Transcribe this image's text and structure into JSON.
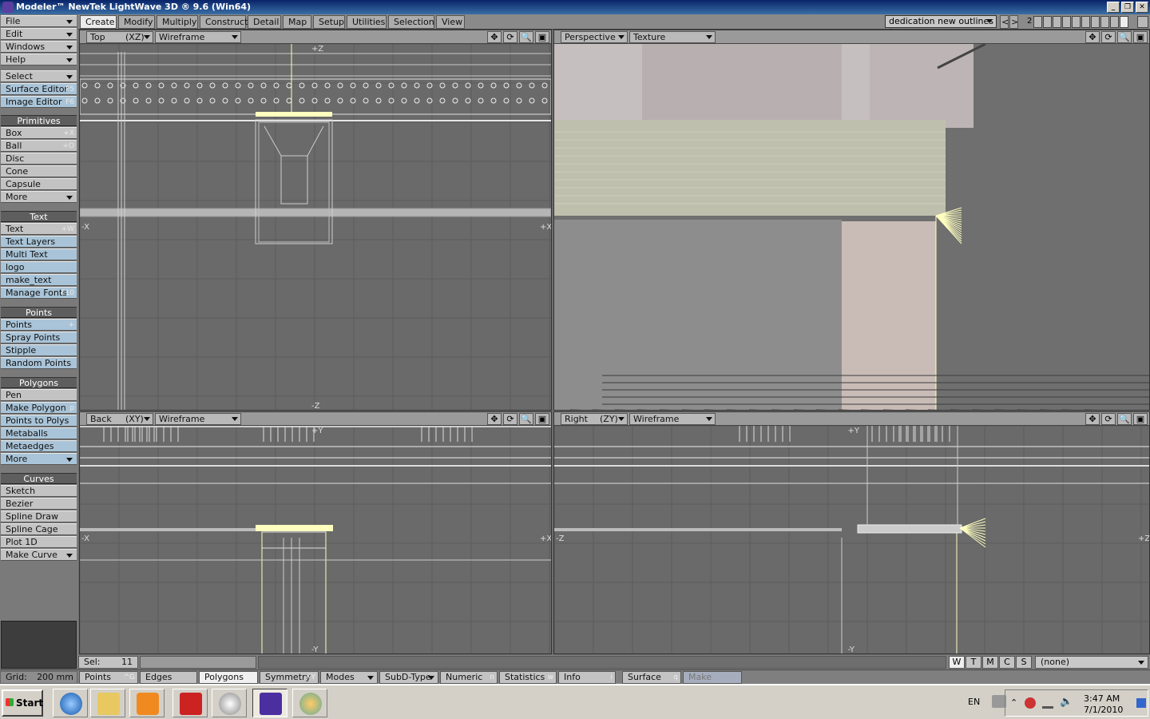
{
  "window": {
    "title": "Modeler™ NewTek LightWave 3D ® 9.6  (Win64)",
    "controls": [
      "_",
      "❐",
      "✕"
    ]
  },
  "sidebar": {
    "menus": [
      {
        "label": "File"
      },
      {
        "label": "Edit"
      },
      {
        "label": "Windows"
      },
      {
        "label": "Help"
      }
    ],
    "select": {
      "label": "Select"
    },
    "editors": [
      {
        "label": "Surface Editor",
        "key": "F5"
      },
      {
        "label": "Image Editor",
        "key": "F6"
      }
    ],
    "groups": [
      {
        "title": "Primitives",
        "items": [
          {
            "label": "Box",
            "key": "+X"
          },
          {
            "label": "Ball",
            "key": "+O"
          },
          {
            "label": "Disc",
            "key": ""
          },
          {
            "label": "Cone",
            "key": ""
          },
          {
            "label": "Capsule",
            "key": ""
          },
          {
            "label": "More",
            "key": "",
            "dd": true
          }
        ]
      },
      {
        "title": "Text",
        "items": [
          {
            "label": "Text",
            "key": "+W"
          },
          {
            "label": "Text Layers",
            "key": ""
          },
          {
            "label": "Multi Text",
            "key": ""
          },
          {
            "label": "logo",
            "key": ""
          },
          {
            "label": "make_text",
            "key": ""
          },
          {
            "label": "Manage Fonts",
            "key": "F10"
          }
        ]
      },
      {
        "title": "Points",
        "items": [
          {
            "label": "Points",
            "key": "+"
          },
          {
            "label": "Spray Points",
            "key": ""
          },
          {
            "label": "Stipple",
            "key": ""
          },
          {
            "label": "Random Points",
            "key": ""
          }
        ]
      },
      {
        "title": "Polygons",
        "items": [
          {
            "label": "Pen",
            "key": ""
          },
          {
            "label": "Make Polygon",
            "key": "p"
          },
          {
            "label": "Points to Polys",
            "key": ""
          },
          {
            "label": "Metaballs",
            "key": ""
          },
          {
            "label": "Metaedges",
            "key": ""
          },
          {
            "label": "More",
            "key": "",
            "dd": true
          }
        ]
      },
      {
        "title": "Curves",
        "items": [
          {
            "label": "Sketch",
            "key": ""
          },
          {
            "label": "Bezier",
            "key": ""
          },
          {
            "label": "Spline Draw",
            "key": ""
          },
          {
            "label": "Spline Cage",
            "key": ""
          },
          {
            "label": "Plot 1D",
            "key": ""
          },
          {
            "label": "Make Curve",
            "key": "",
            "dd": true
          }
        ]
      }
    ]
  },
  "tabs": [
    {
      "label": "Create",
      "active": true
    },
    {
      "label": "Modify"
    },
    {
      "label": "Multiply"
    },
    {
      "label": "Construct"
    },
    {
      "label": "Detail"
    },
    {
      "label": "Map"
    },
    {
      "label": "Setup"
    },
    {
      "label": "Utilities"
    },
    {
      "label": "Selection"
    },
    {
      "label": "View"
    }
  ],
  "scene_selector": {
    "value": "dedication new outlines *",
    "layer_nav": [
      "<",
      ">"
    ],
    "layer_number": "2"
  },
  "viewports": [
    {
      "view": "Top",
      "axis": "(XZ)",
      "mode": "Wireframe",
      "labels": {
        "top": "+Z",
        "bottom": "-Z",
        "left": "-X",
        "right": "+X"
      }
    },
    {
      "view": "Perspective",
      "axis": "",
      "mode": "Texture",
      "labels": {}
    },
    {
      "view": "Back",
      "axis": "(XY)",
      "mode": "Wireframe",
      "labels": {
        "top": "+Y",
        "bottom": "-Y",
        "left": "-X",
        "right": "+X"
      }
    },
    {
      "view": "Right",
      "axis": "(ZY)",
      "mode": "Wireframe",
      "labels": {
        "top": "+Y",
        "bottom": "-Y",
        "left": "-Z",
        "right": "+Z"
      }
    }
  ],
  "viewport_icons": [
    "✥",
    "⟳",
    "🔍",
    "▣"
  ],
  "status": {
    "sel_label": "Sel:",
    "sel_count": "11",
    "wtmcs": [
      "W",
      "T",
      "M",
      "C",
      "S"
    ],
    "surface_value": "(none)"
  },
  "bottom": {
    "grid_label": "Grid:",
    "grid_value": "200 mm",
    "buttons": [
      {
        "label": "Points",
        "key": "^G"
      },
      {
        "label": "Edges",
        "key": ""
      },
      {
        "label": "Polygons",
        "key": "^H"
      },
      {
        "label": "Symmetry",
        "key": "+Y"
      },
      {
        "label": "Modes",
        "key": "",
        "dd": true
      },
      {
        "label": "SubD-Type",
        "key": "",
        "dd": true
      },
      {
        "label": "Numeric",
        "key": "n"
      },
      {
        "label": "Statistics",
        "key": "w"
      },
      {
        "label": "Info",
        "key": "i"
      },
      {
        "label": "Surface",
        "key": "q"
      },
      {
        "label": "Make",
        "key": ""
      }
    ]
  },
  "taskbar": {
    "start": "Start",
    "language": "EN",
    "time": "3:47 AM",
    "date": "7/1/2010"
  },
  "colors": {
    "selected_yellow": "#ffffc0",
    "sidebar_highlight": "#a9c4d8",
    "grid": "#5a5a5a"
  }
}
